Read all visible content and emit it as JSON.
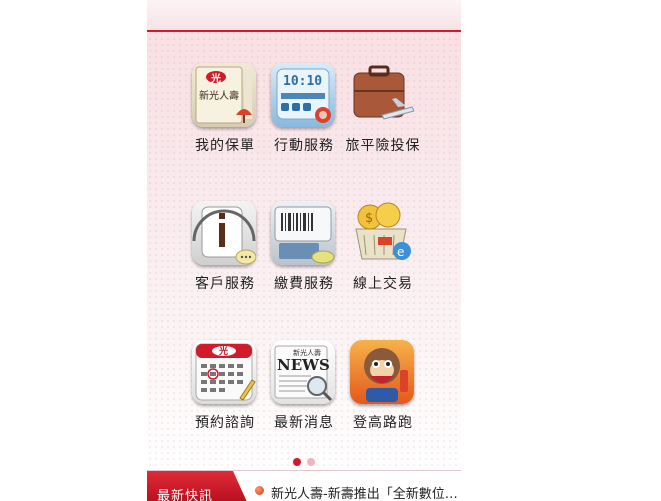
{
  "app": {
    "menu_items": [
      {
        "label": "我的保單",
        "icon": "policy-book-icon"
      },
      {
        "label": "行動服務",
        "icon": "mobile-service-icon"
      },
      {
        "label": "旅平險投保",
        "icon": "travel-insurance-icon"
      },
      {
        "label": "客戶服務",
        "icon": "customer-service-icon"
      },
      {
        "label": "繳費服務",
        "icon": "payment-icon"
      },
      {
        "label": "線上交易",
        "icon": "online-trade-icon"
      },
      {
        "label": "預約諮詢",
        "icon": "calendar-icon"
      },
      {
        "label": "最新消息",
        "icon": "news-icon"
      },
      {
        "label": "登高路跑",
        "icon": "mascot-run-icon"
      }
    ],
    "icon_texts": {
      "brand_mark": "光",
      "brand_name": "新光人壽",
      "clock_time": "10:10",
      "news_word": "NEWS"
    },
    "pager": {
      "current": 1,
      "total": 2
    },
    "ticker": {
      "tag": "最新快訊",
      "text": "新光人壽-新壽推出「全新數位…"
    },
    "colors": {
      "brand_red": "#d11a2a",
      "page_pink": "#f8e3e7",
      "active_dot": "#d11a2a",
      "inactive_dot": "#f0b3bf"
    }
  }
}
